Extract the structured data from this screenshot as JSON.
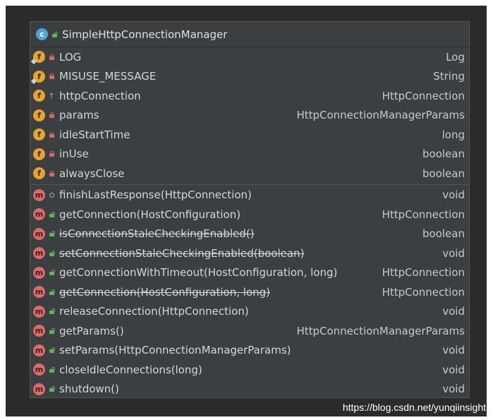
{
  "class_name": "SimpleHttpConnectionManager",
  "fields": [
    {
      "name": "LOG",
      "type": "Log",
      "vis": "private",
      "static": true
    },
    {
      "name": "MISUSE_MESSAGE",
      "type": "String",
      "vis": "private",
      "static": true
    },
    {
      "name": "httpConnection",
      "type": "HttpConnection",
      "vis": "package"
    },
    {
      "name": "params",
      "type": "HttpConnectionManagerParams",
      "vis": "private"
    },
    {
      "name": "idleStartTime",
      "type": "long",
      "vis": "private"
    },
    {
      "name": "inUse",
      "type": "boolean",
      "vis": "private"
    },
    {
      "name": "alwaysClose",
      "type": "boolean",
      "vis": "private"
    }
  ],
  "methods": [
    {
      "name": "finishLastResponse(HttpConnection)",
      "type": "void",
      "vis": "protected"
    },
    {
      "name": "getConnection(HostConfiguration)",
      "type": "HttpConnection",
      "vis": "public"
    },
    {
      "name": "isConnectionStaleCheckingEnabled()",
      "type": "boolean",
      "vis": "public",
      "deprecated": true
    },
    {
      "name": "setConnectionStaleCheckingEnabled(boolean)",
      "type": "void",
      "vis": "public",
      "deprecated": true
    },
    {
      "name": "getConnectionWithTimeout(HostConfiguration, long)",
      "type": "HttpConnection",
      "vis": "public"
    },
    {
      "name": "getConnection(HostConfiguration, long)",
      "type": "HttpConnection",
      "vis": "public",
      "deprecated": true
    },
    {
      "name": "releaseConnection(HttpConnection)",
      "type": "void",
      "vis": "public"
    },
    {
      "name": "getParams()",
      "type": "HttpConnectionManagerParams",
      "vis": "public"
    },
    {
      "name": "setParams(HttpConnectionManagerParams)",
      "type": "void",
      "vis": "public"
    },
    {
      "name": "closeIdleConnections(long)",
      "type": "void",
      "vis": "public"
    },
    {
      "name": "shutdown()",
      "type": "void",
      "vis": "public"
    }
  ],
  "watermark": "https://blog.csdn.net/yunqiinsight",
  "colors": {
    "field_icon": "#e8a32e",
    "method_icon": "#d96b6b",
    "class_icon": "#4ea6d8",
    "private": "#d46a6a",
    "public": "#63b35d"
  }
}
